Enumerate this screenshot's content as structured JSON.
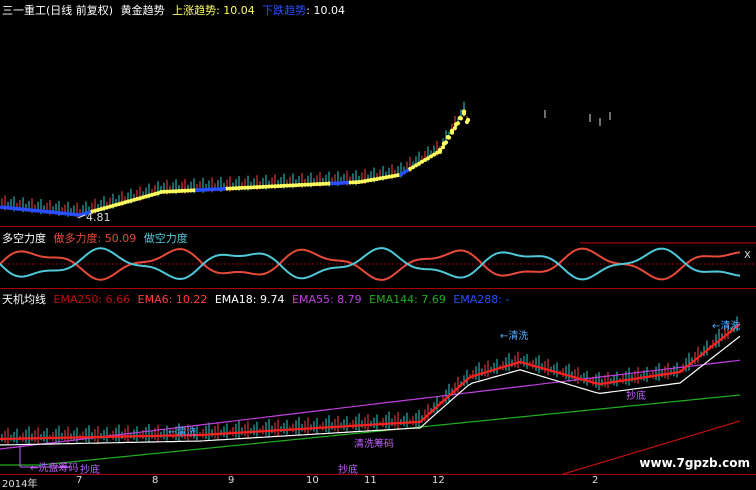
{
  "panel1": {
    "stock": "三一重工(日线 前复权)",
    "indicator": "黄金趋势",
    "up_label": "上涨趋势",
    "up_value": ": 10.04",
    "down_label": "下跌趋势",
    "down_value": ": 10.04",
    "low_label": "4.81"
  },
  "panel2": {
    "title": "多空力度",
    "bull_label": "做多力度",
    "bull_value": ": 50.09",
    "bear_label": "做空力度",
    "side_label": "X"
  },
  "panel3": {
    "title": "天机均线",
    "ema250": "EMA250: 6.66",
    "ema6": "EMA6: 10.22",
    "ema18": "EMA18: 9.74",
    "ema55": "EMA55: 8.79",
    "ema144": "EMA144: 7.69",
    "ema288": "EMA288: -",
    "annotations": {
      "a1": "←洗盘筹码",
      "a2": "抄底",
      "a3": "←清洗",
      "a4": "清洗筹码",
      "a5": "←清洗",
      "a6": "抄底",
      "a7": "←清洗",
      "a8": "抄底"
    }
  },
  "xaxis": {
    "labels": [
      "2014年",
      "7",
      "8",
      "9",
      "10",
      "11",
      "12",
      "2"
    ]
  },
  "watermark": "www.7gpzb.com",
  "colors": {
    "up": "#ffff60",
    "down": "#2a4fff",
    "bull": "#e84a3a",
    "bear": "#4fc8d8",
    "ema6": "#ff2020",
    "ema18": "#ffffff",
    "ema55": "#c040e0",
    "ema144": "#20b020",
    "ema250": "#c01010"
  }
}
